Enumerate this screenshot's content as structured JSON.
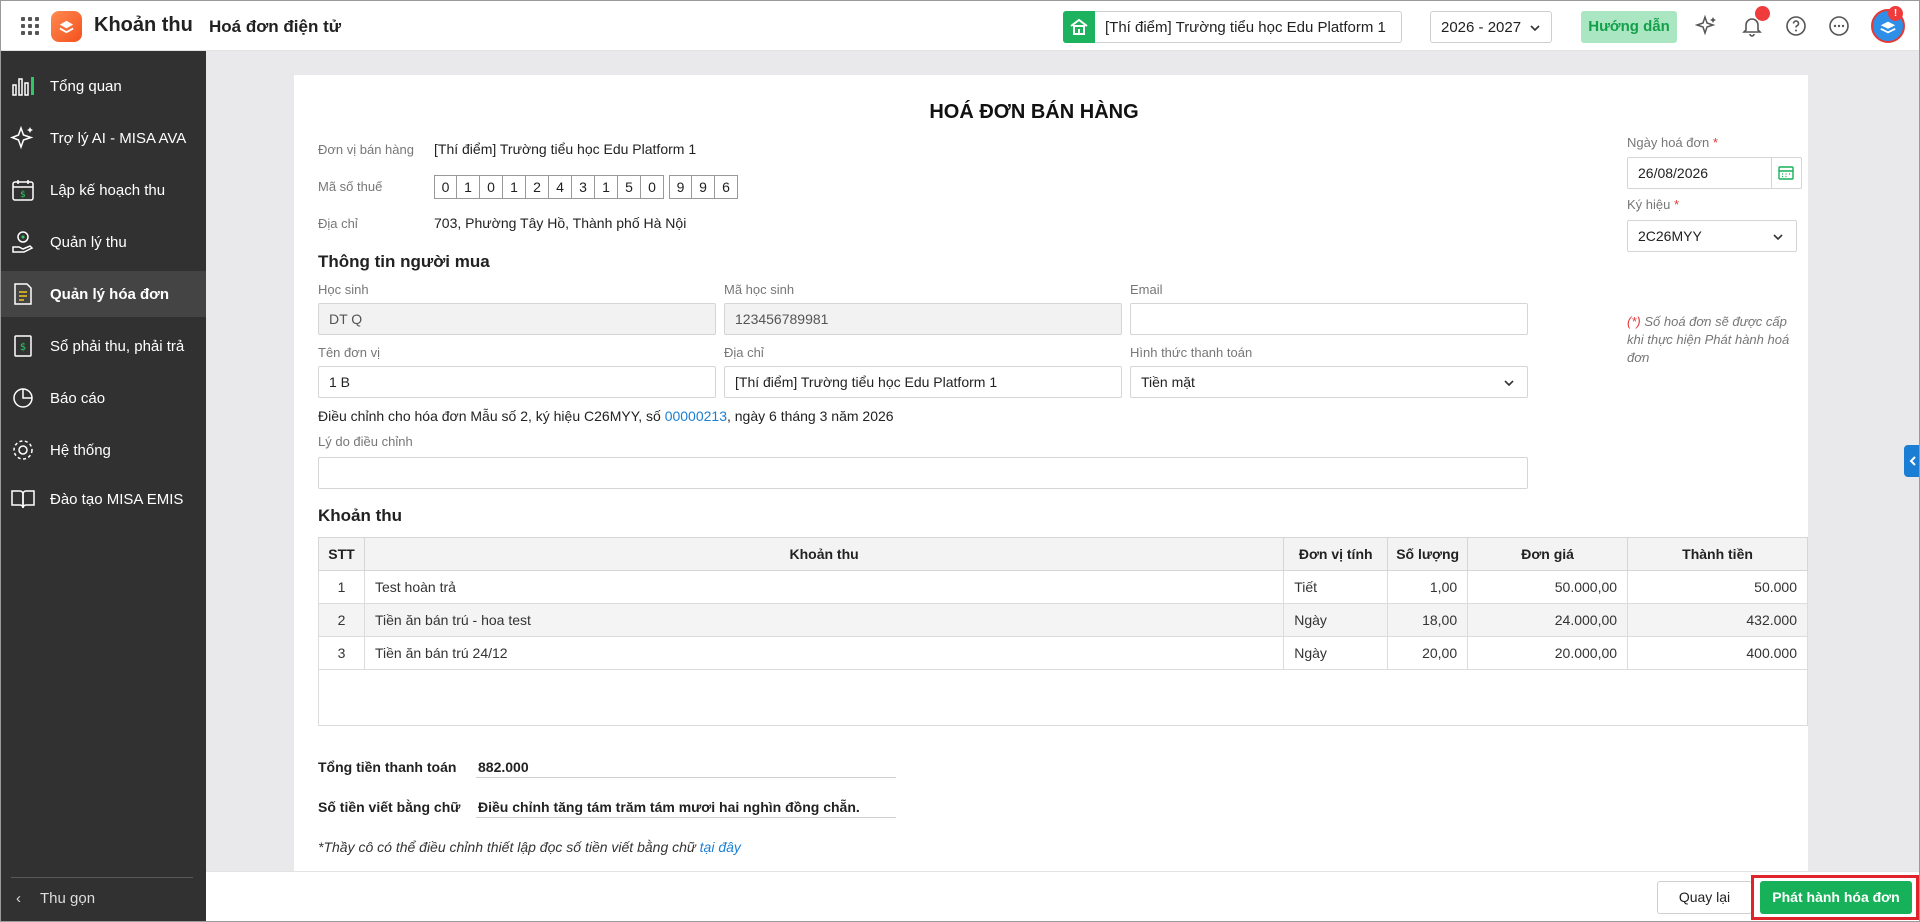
{
  "header": {
    "app_name": "Khoản thu",
    "page_name": "Hoá đơn điện tử",
    "school": "[Thí điểm] Trường tiểu học Edu Platform 1",
    "year": "2026 - 2027",
    "guide_label": "Hướng dẫn",
    "avatar_badge": "!"
  },
  "sidebar": {
    "items": [
      {
        "label": "Tổng quan",
        "icon": "bar-chart-icon"
      },
      {
        "label": "Trợ lý AI - MISA AVA",
        "icon": "sparkle-icon"
      },
      {
        "label": "Lập kế hoạch thu",
        "icon": "calendar-money-icon"
      },
      {
        "label": "Quản lý thu",
        "icon": "hand-coin-icon"
      },
      {
        "label": "Quản lý hóa đơn",
        "icon": "document-icon"
      },
      {
        "label": "Sổ phải thu, phải trả",
        "icon": "ledger-icon"
      },
      {
        "label": "Báo cáo",
        "icon": "pie-chart-icon"
      },
      {
        "label": "Hệ thống",
        "icon": "gear-icon"
      },
      {
        "label": "Đào tạo MISA EMIS",
        "icon": "book-icon"
      }
    ],
    "active_index": 4,
    "collapse_label": "Thu gọn"
  },
  "invoice": {
    "title": "HOÁ ĐƠN BÁN HÀNG",
    "seller_label": "Đơn vị bán hàng",
    "seller_value": "[Thí điểm] Trường tiểu học Edu Platform 1",
    "tax_label": "Mã số thuế",
    "tax_digits_main": [
      "0",
      "1",
      "0",
      "1",
      "2",
      "4",
      "3",
      "1",
      "5",
      "0"
    ],
    "tax_digits_branch": [
      "9",
      "9",
      "6"
    ],
    "address_label": "Địa chỉ",
    "address_value": "703, Phường Tây Hồ, Thành phố Hà Nội",
    "date_label": "Ngày hoá đơn",
    "date_value": "26/08/2026",
    "symbol_label": "Ký hiệu",
    "symbol_value": "2C26MYY",
    "required_mark": "*",
    "number_note_prefix": "(*)",
    "number_note": "Số hoá đơn sẽ được cấp khi thực hiện Phát hành hoá đơn"
  },
  "buyer": {
    "section_title": "Thông tin người mua",
    "student_label": "Học sinh",
    "student_value": "DT Q",
    "student_code_label": "Mã học sinh",
    "student_code_value": "123456789981",
    "email_label": "Email",
    "email_value": "",
    "unit_label": "Tên đơn vị",
    "unit_value": "1 B",
    "address_label": "Địa chỉ",
    "address_value": "[Thí điểm] Trường tiểu học Edu Platform 1",
    "payment_label": "Hình thức thanh toán",
    "payment_value": "Tiền mặt",
    "adjust_prefix": "Điều chỉnh cho hóa đơn Mẫu số 2, ký hiệu C26MYY, số ",
    "adjust_number": "00000213",
    "adjust_suffix": ", ngày 6 tháng 3 năm 2026",
    "reason_label": "Lý do điều chỉnh",
    "reason_value": ""
  },
  "fees": {
    "section_title": "Khoản thu",
    "columns": [
      "STT",
      "Khoản thu",
      "Đơn vị tính",
      "Số lượng",
      "Đơn giá",
      "Thành tiền"
    ],
    "rows": [
      {
        "stt": "1",
        "name": "Test hoàn trả",
        "unit": "Tiết",
        "qty": "1,00",
        "price": "50.000,00",
        "amount": "50.000"
      },
      {
        "stt": "2",
        "name": "Tiền ăn bán trú - hoa test",
        "unit": "Ngày",
        "qty": "18,00",
        "price": "24.000,00",
        "amount": "432.000"
      },
      {
        "stt": "3",
        "name": "Tiền ăn bán trú 24/12",
        "unit": "Ngày",
        "qty": "20,00",
        "price": "20.000,00",
        "amount": "400.000"
      }
    ]
  },
  "summary": {
    "total_label": "Tổng tiền thanh toán",
    "total_value": "882.000",
    "words_label": "Số tiền viết bằng chữ",
    "words_value": "Điều chỉnh tăng tám trăm tám mươi hai nghìn đồng chẵn.",
    "note_text": "*Thầy cô có thể điều chỉnh thiết lập đọc số tiền viết bằng chữ ",
    "note_link": "tại đây"
  },
  "actions": {
    "back_label": "Quay lại",
    "issue_label": "Phát hành hóa đơn"
  },
  "colors": {
    "brand_green": "#16b158",
    "link_blue": "#1a7fd4",
    "sidebar_bg": "#313131",
    "highlight_red": "#e0242c"
  }
}
